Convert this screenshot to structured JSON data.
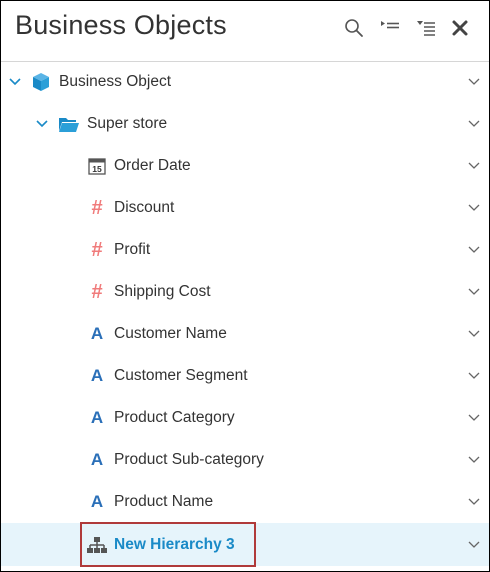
{
  "header": {
    "title": "Business Objects",
    "icons": [
      "search-icon",
      "collapse-icon",
      "list-filter-icon",
      "close-icon"
    ]
  },
  "tree": {
    "root": {
      "label": "Business Object",
      "icon": "cube-icon"
    },
    "folder": {
      "label": "Super store",
      "icon": "folder-open-icon"
    },
    "items": [
      {
        "label": "Order Date",
        "icon": "calendar-icon"
      },
      {
        "label": "Discount",
        "icon": "measure-hash-icon"
      },
      {
        "label": "Profit",
        "icon": "measure-hash-icon"
      },
      {
        "label": "Shipping Cost",
        "icon": "measure-hash-icon"
      },
      {
        "label": "Customer Name",
        "icon": "dimension-a-icon"
      },
      {
        "label": "Customer Segment",
        "icon": "dimension-a-icon"
      },
      {
        "label": "Product Category",
        "icon": "dimension-a-icon"
      },
      {
        "label": "Product Sub-category",
        "icon": "dimension-a-icon"
      },
      {
        "label": "Product Name",
        "icon": "dimension-a-icon"
      },
      {
        "label": "New Hierarchy 3",
        "icon": "hierarchy-icon",
        "selected": true
      }
    ]
  },
  "colors": {
    "accent": "#1a8ac7",
    "measure": "#f07b7b",
    "dimension": "#2a6fb8",
    "selected_bg": "#e6f4fb",
    "highlight_border": "#b03a3a"
  }
}
